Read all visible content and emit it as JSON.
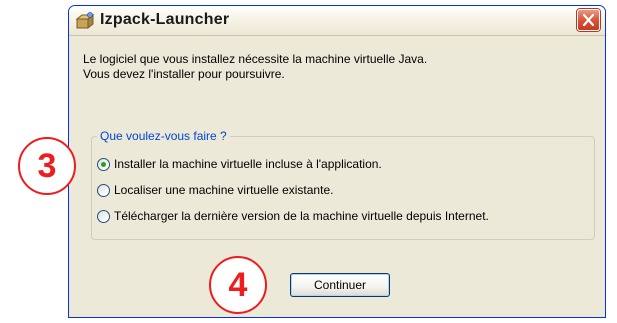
{
  "window": {
    "title": "Izpack-Launcher",
    "close_icon": "close-icon",
    "app_icon": "izpack-app-icon"
  },
  "message": {
    "line1": "Le logiciel que vous installez nécessite la machine virtuelle Java.",
    "line2": "Vous devez l'installer pour poursuivre."
  },
  "group": {
    "title": "Que voulez-vous faire ?",
    "options": [
      {
        "label": "Installer la machine virtuelle incluse à l'application.",
        "selected": true
      },
      {
        "label": "Localiser une machine virtuelle existante.",
        "selected": false
      },
      {
        "label": "Télécharger la dernière version de la machine virtuelle depuis Internet.",
        "selected": false
      }
    ]
  },
  "buttons": {
    "continue_label": "Continuer"
  },
  "annotations": {
    "step_3": "3",
    "step_4": "4"
  },
  "colors": {
    "window_border": "#0831d9",
    "group_title": "#0046d5",
    "radio_selected": "#21a121",
    "close_button": "#d9553a",
    "annotation": "#ee1c1c"
  }
}
